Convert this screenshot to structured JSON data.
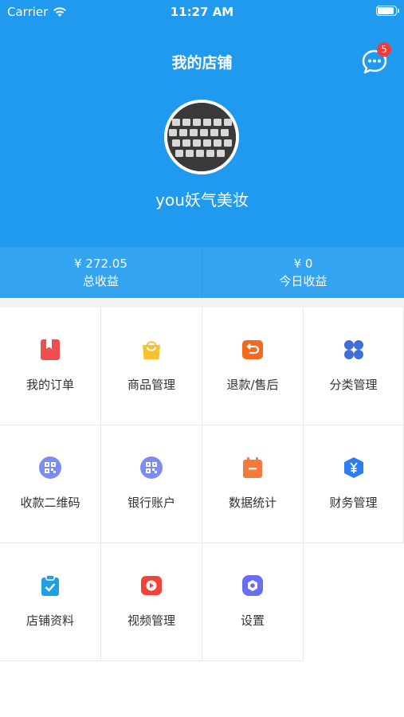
{
  "status": {
    "carrier": "Carrier",
    "time": "11:27 AM"
  },
  "header": {
    "title": "我的店铺",
    "message_badge": "5",
    "shop_name": "you妖气美妆"
  },
  "earnings": [
    {
      "value": "¥ 272.05",
      "label": "总收益"
    },
    {
      "value": "¥ 0",
      "label": "今日收益"
    }
  ],
  "menu": [
    {
      "label": "我的订单",
      "icon": "bookmark-icon",
      "color": "#f04e4e"
    },
    {
      "label": "商品管理",
      "icon": "shopping-bag-icon",
      "color": "#fbc02d"
    },
    {
      "label": "退款/售后",
      "icon": "refund-icon",
      "color": "#f36a1e"
    },
    {
      "label": "分类管理",
      "icon": "category-icon",
      "color": "#3f6fd8"
    },
    {
      "label": "收款二维码",
      "icon": "qr-code-icon",
      "color": "#7d8cf0"
    },
    {
      "label": "银行账户",
      "icon": "qr-code-icon",
      "color": "#7d8cf0"
    },
    {
      "label": "数据统计",
      "icon": "calendar-icon",
      "color": "#f5793a"
    },
    {
      "label": "财务管理",
      "icon": "yen-shield-icon",
      "color": "#2d7cf0"
    },
    {
      "label": "店铺资料",
      "icon": "clipboard-check-icon",
      "color": "#1fa0e6"
    },
    {
      "label": "视频管理",
      "icon": "video-play-icon",
      "color": "#f0443a"
    },
    {
      "label": "设置",
      "icon": "settings-icon",
      "color": "#6a6ef2"
    }
  ]
}
